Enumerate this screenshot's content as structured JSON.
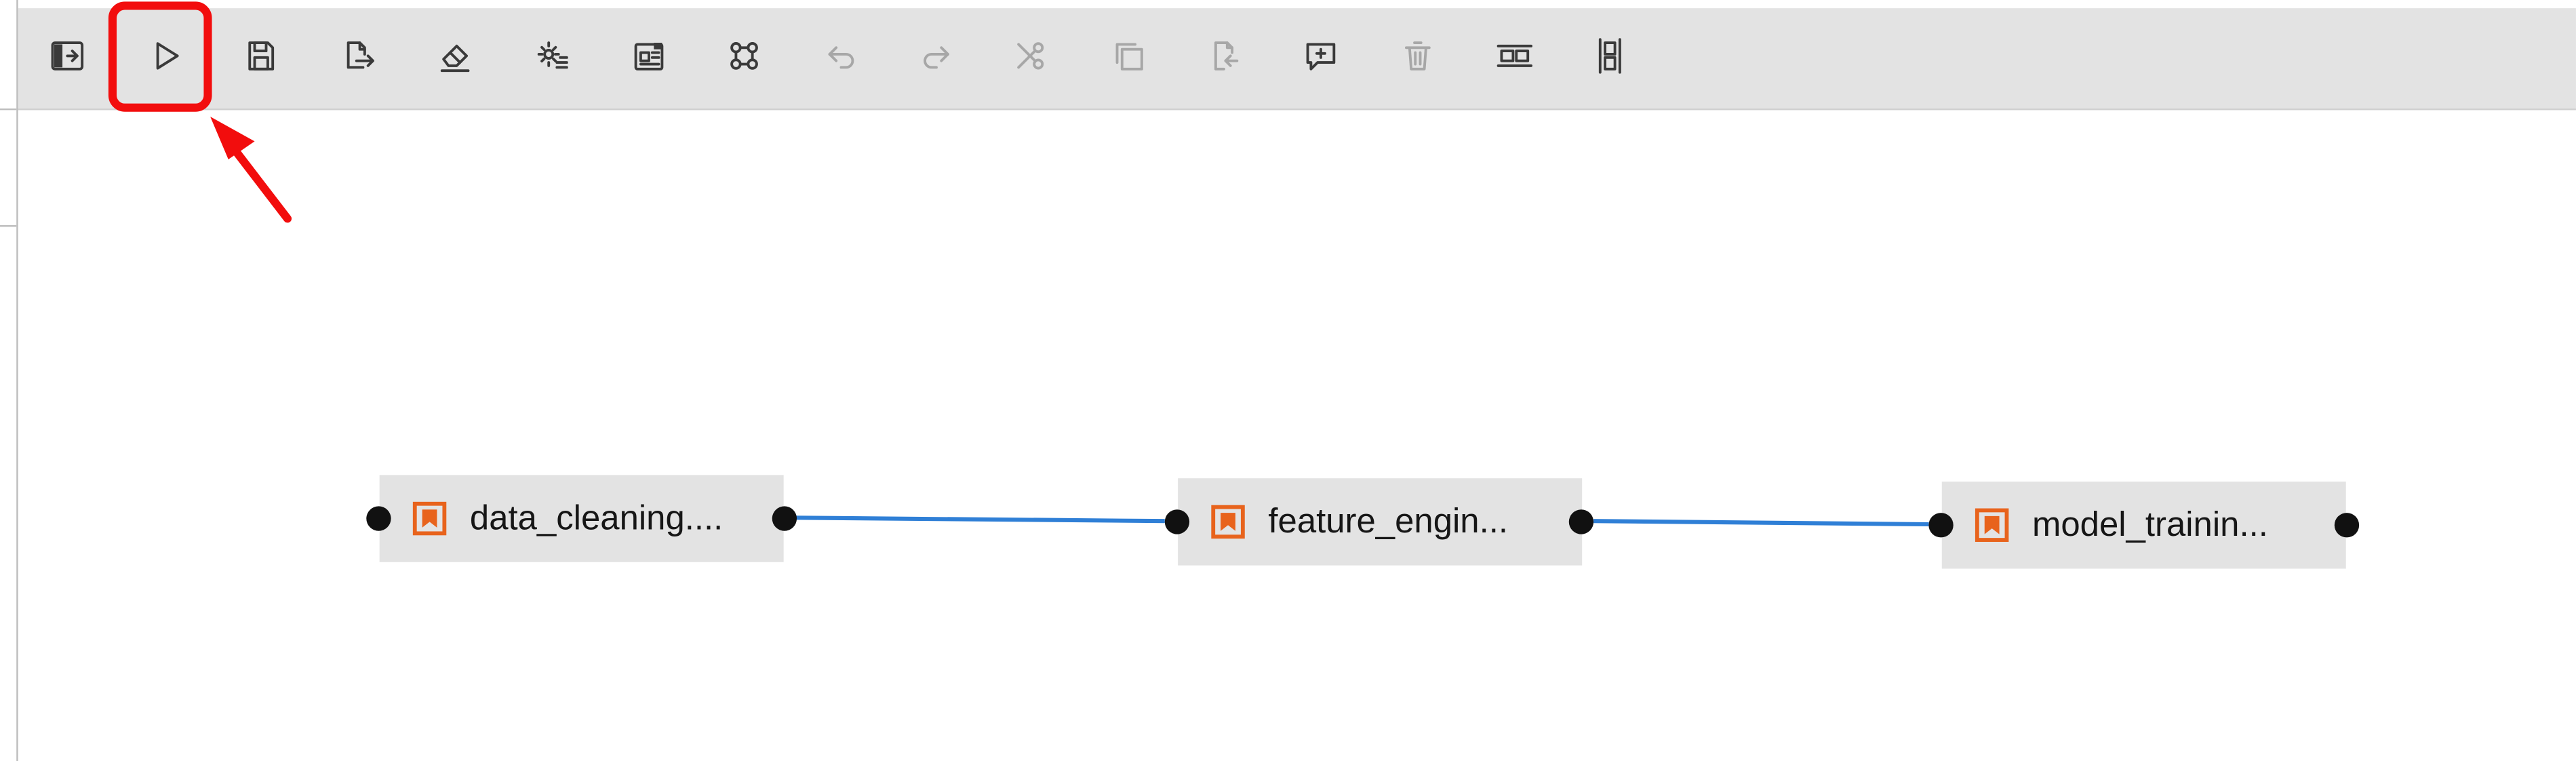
{
  "toolbar": {
    "buttons": [
      {
        "icon": "toggle-panel-icon",
        "enabled": true
      },
      {
        "icon": "run-pipeline-icon",
        "enabled": true,
        "highlighted": true
      },
      {
        "icon": "save-icon",
        "enabled": true
      },
      {
        "icon": "export-icon",
        "enabled": true
      },
      {
        "icon": "clear-icon",
        "enabled": true
      },
      {
        "icon": "settings-icon",
        "enabled": true
      },
      {
        "icon": "open-panel-icon",
        "enabled": true
      },
      {
        "icon": "runtimes-icon",
        "enabled": true
      },
      {
        "icon": "undo-icon",
        "enabled": false
      },
      {
        "icon": "redo-icon",
        "enabled": false
      },
      {
        "icon": "cut-icon",
        "enabled": false
      },
      {
        "icon": "copy-icon",
        "enabled": false
      },
      {
        "icon": "paste-icon",
        "enabled": false
      },
      {
        "icon": "add-comment-icon",
        "enabled": true
      },
      {
        "icon": "delete-icon",
        "enabled": false
      },
      {
        "icon": "arrange-horizontal-icon",
        "enabled": true
      },
      {
        "icon": "arrange-vertical-icon",
        "enabled": true
      }
    ]
  },
  "nodes": [
    {
      "label": "data_cleaning...."
    },
    {
      "label": "feature_engin..."
    },
    {
      "label": "model_trainin..."
    }
  ],
  "colors": {
    "accent": "#f20d0d",
    "link": "#2f7fd6",
    "node_icon": "#e8631c"
  }
}
